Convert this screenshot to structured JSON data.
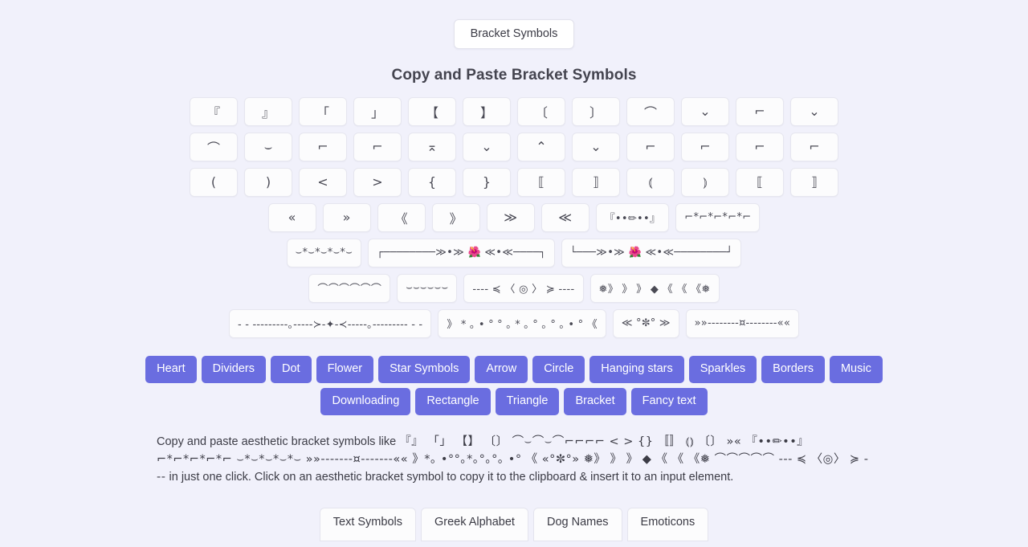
{
  "header": {
    "nav_pill_label": "Bracket Symbols",
    "title": "Copy and Paste Bracket Symbols"
  },
  "theme": {
    "page_background": "#f1f1fb",
    "tile_background": "#fcfcfd",
    "tile_border": "#e6e6ef",
    "category_button_background": "#6a6de0",
    "category_button_text": "#ffffff",
    "heading_text": "#44444f",
    "body_text": "#3c3c46"
  },
  "symbol_rows": [
    {
      "size": "normal",
      "symbols": [
        "『",
        "』",
        "「",
        "」",
        "【",
        "】",
        "〔",
        "〕",
        "⌒",
        "⌄",
        "⌐",
        "⌄"
      ]
    },
    {
      "size": "normal",
      "symbols": [
        "⌒",
        "⌣",
        "⌐",
        "⌐",
        "⌅",
        "⌄",
        "⌃",
        "⌄",
        "⌐",
        "⌐",
        "⌐",
        "⌐"
      ]
    },
    {
      "size": "normal",
      "symbols": [
        "(",
        ")",
        "<",
        ">",
        "{",
        "}",
        "⟦",
        "⟧",
        "⦅",
        "⦆",
        "⟦",
        "⟧"
      ]
    },
    {
      "size": "mixed",
      "symbols": [
        "«",
        "»",
        "《",
        "》",
        "≫",
        "≪",
        "『••✏••』",
        "⌐*⌐*⌐*⌐*⌐"
      ]
    },
    {
      "size": "long",
      "symbols": [
        "⌣*⌣*⌣*⌣*⌣",
        "┌────────≫•≫ 🌺 ≪•≪────┐",
        "└───≫•≫ 🌺 ≪•≪────────┘"
      ]
    },
    {
      "size": "long",
      "symbols": [
        "⌒⌒⌒⌒⌒⌒",
        "⌣⌣⌣⌣⌣⌣",
        "---- ≼  〈 ◎ 〉  ≽ ----",
        "❅》 》 》 ◆ 《 《 《❅"
      ]
    },
    {
      "size": "long",
      "symbols": [
        "- - ---------｡-----≻-✦-≺-----｡--------- - -",
        "》 *  ｡  • ° ° ｡ * ｡ ° ｡ ° ｡  • ° 《",
        "≪ °✼° ≫",
        "»»--------¤--------««"
      ]
    }
  ],
  "categories": {
    "row1": [
      "Heart",
      "Dividers",
      "Dot",
      "Flower",
      "Star Symbols",
      "Arrow",
      "Circle",
      "Hanging stars",
      "Sparkles",
      "Borders",
      "Music"
    ],
    "row2": [
      "Downloading",
      "Rectangle",
      "Triangle",
      "Bracket",
      "Fancy text"
    ]
  },
  "description": {
    "lead": "Copy and paste aesthetic bracket symbols like",
    "glyph_block": "『』 「」 【】 〔〕 ⌒⌣⌒⌣⌒⌐⌐⌐⌐ < > {} 〚〛 ⦅⦆ 〔〕 »« 『••✏••』 ⌐*⌐*⌐*⌐*⌐ ⌣*⌣*⌣*⌣*⌣ »»-------¤-------«« 》*｡ •°°｡*｡°｡°｡ •° 《 «°✼°» ❅》 》 》 ◆ 《 《 《❅ ⌒⌒⌒⌒⌒ --- ≼ 〈◎〉 ≽ ---",
    "tail": "in just one click. Click on an aesthetic bracket symbol to copy it to the clipboard & insert it to an input element."
  },
  "bottom_tabs": [
    "Text Symbols",
    "Greek Alphabet",
    "Dog Names",
    "Emoticons"
  ]
}
